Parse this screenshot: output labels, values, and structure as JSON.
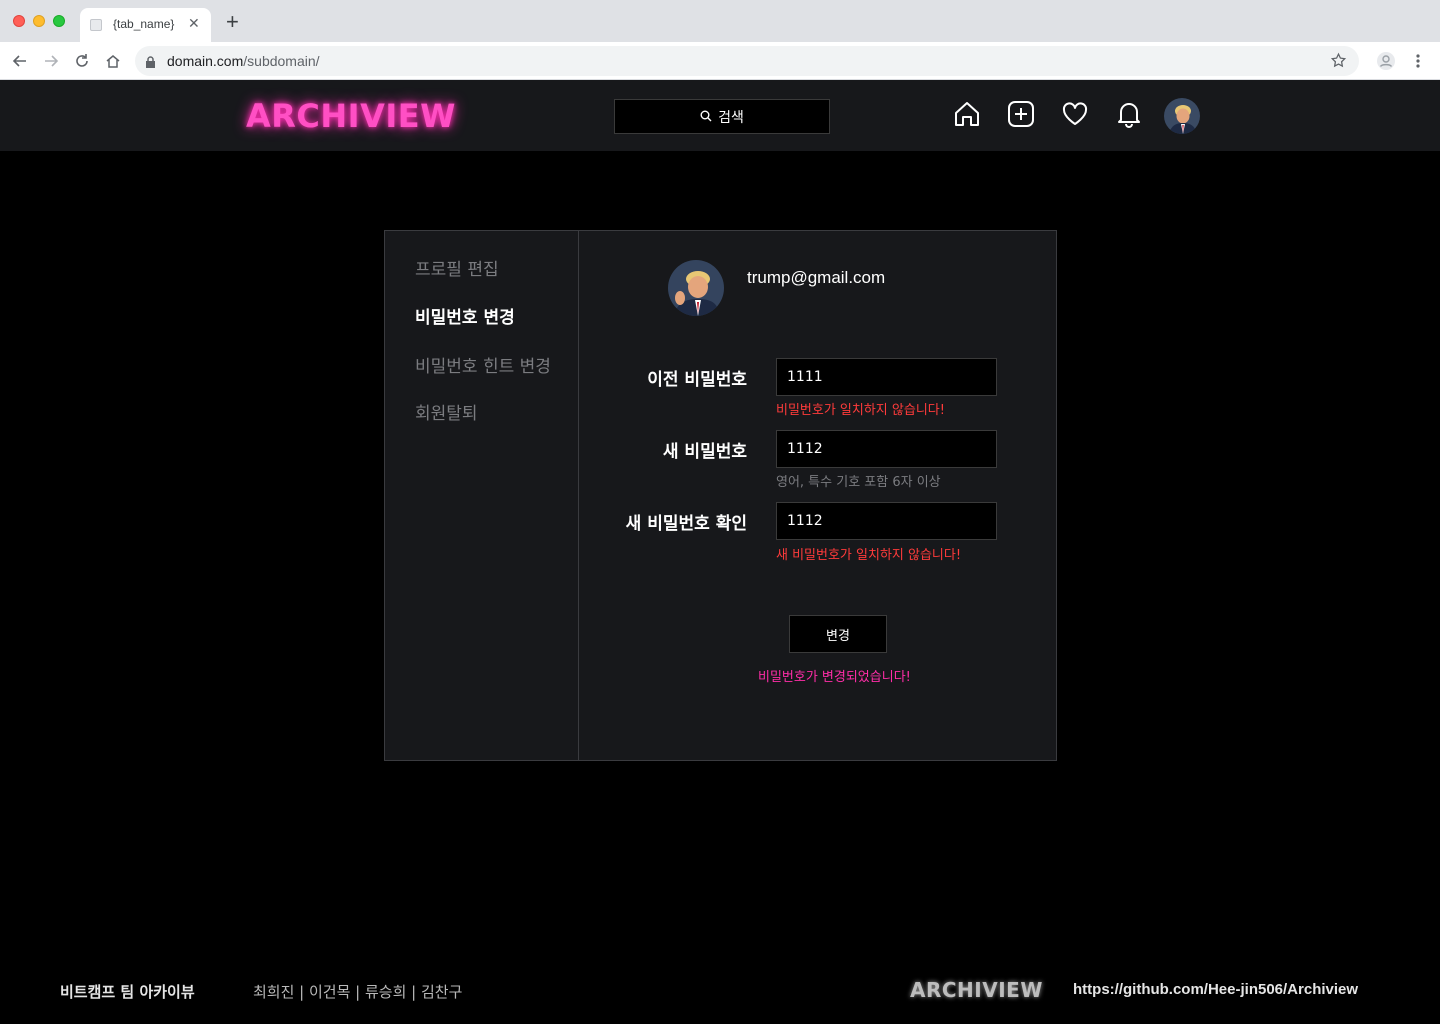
{
  "browser": {
    "tab_title": "{tab_name}",
    "url_domain": "domain.com",
    "url_path": "/subdomain/"
  },
  "header": {
    "logo": "ARCHIVIEW",
    "search_placeholder": "검색"
  },
  "sidebar": {
    "items": [
      {
        "label": "프로필 편집",
        "active": false
      },
      {
        "label": "비밀번호 변경",
        "active": true
      },
      {
        "label": "비밀번호 힌트 변경",
        "active": false
      },
      {
        "label": "회원탈퇴",
        "active": false
      }
    ]
  },
  "profile": {
    "email": "trump@gmail.com"
  },
  "form": {
    "old_password": {
      "label": "이전 비밀번호",
      "value": "1111",
      "message": "비밀번호가 일치하지 않습니다!"
    },
    "new_password": {
      "label": "새 비밀번호",
      "value": "1112",
      "message": "영어, 특수 기호 포함 6자 이상"
    },
    "confirm_password": {
      "label": "새 비밀번호 확인",
      "value": "1112",
      "message": "새 비밀번호가 일치하지 않습니다!"
    },
    "submit_label": "변경",
    "success_message": "비밀번호가 변경되었습니다!"
  },
  "footer": {
    "title": "비트캠프 팀 아카이뷰",
    "team": "최희진 | 이건목 | 류승희 | 김찬구",
    "logo": "ARCHIVIEW",
    "link": "https://github.com/Hee-jin506/Archiview"
  },
  "colors": {
    "accent": "#ff4fc4",
    "error": "#ff3b3b",
    "success": "#ff2da8"
  }
}
